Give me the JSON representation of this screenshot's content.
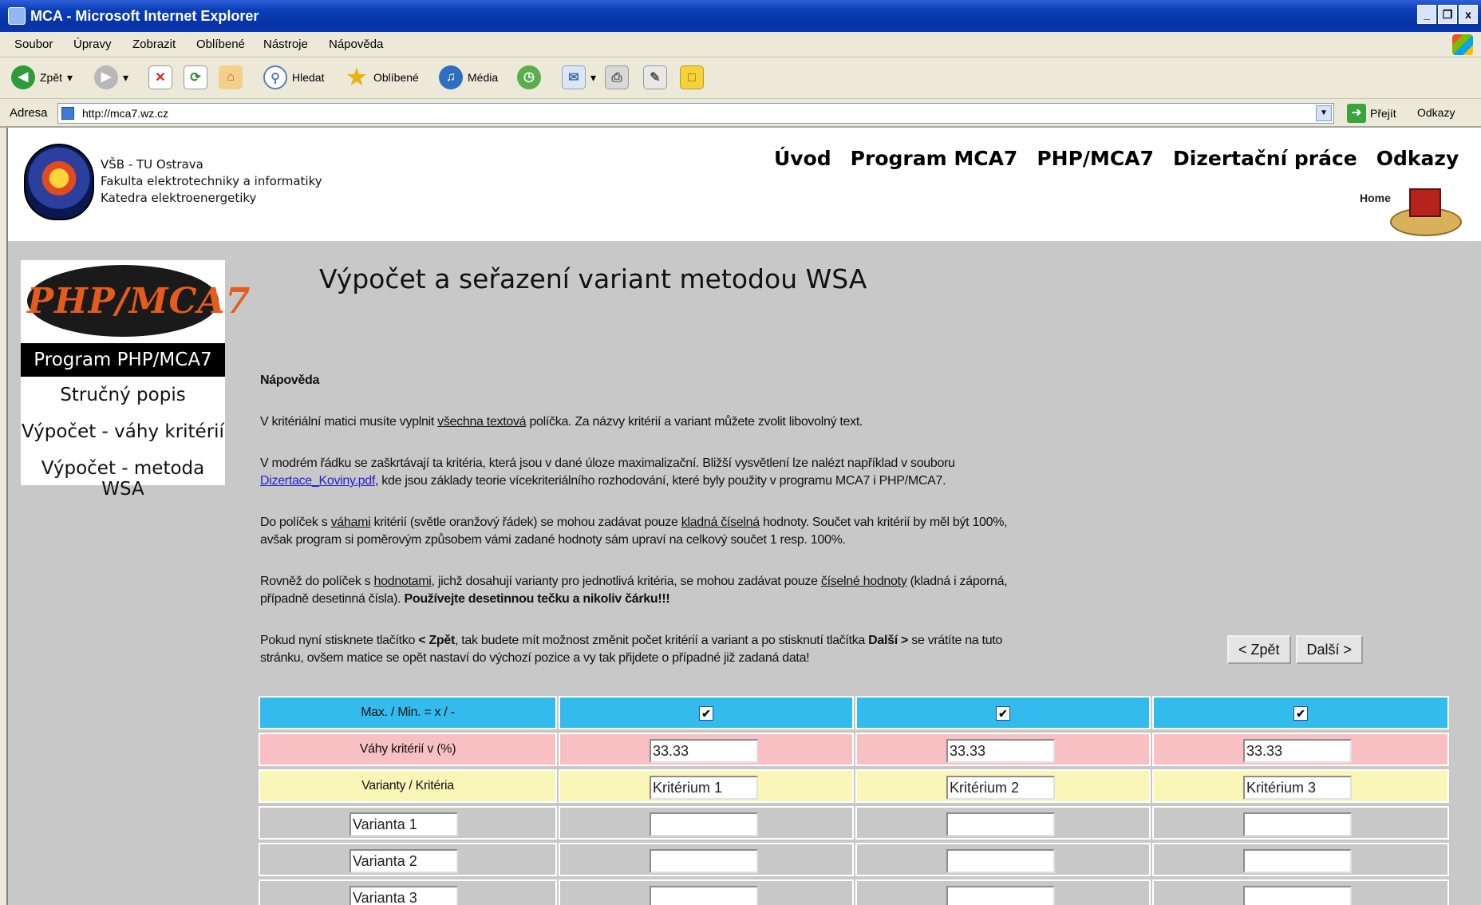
{
  "window": {
    "title": "MCA - Microsoft Internet Explorer",
    "controls": [
      "_",
      "❐",
      "x"
    ]
  },
  "menu": [
    "Soubor",
    "Úpravy",
    "Zobrazit",
    "Oblíbené",
    "Nástroje",
    "Nápověda"
  ],
  "toolbar": {
    "back": "Zpět",
    "search": "Hledat",
    "favorites": "Oblíbené",
    "media": "Média"
  },
  "address": {
    "label": "Adresa",
    "url": "http://mca7.wz.cz",
    "go": "Přejít",
    "links": "Odkazy"
  },
  "header": {
    "uni": [
      "VŠB - TU Ostrava",
      "Fakulta elektrotechniky a informatiky",
      "Katedra elektroenergetiky"
    ],
    "nav": [
      "Úvod",
      "Program MCA7",
      "PHP/MCA7",
      "Dizertační práce",
      "Odkazy"
    ],
    "home": "Home"
  },
  "sidebar": {
    "brand": "PHP/MCA7",
    "current": "Program PHP/MCA7",
    "items": [
      "Stručný popis",
      "Výpočet - váhy kritérií",
      "Výpočet - metoda WSA"
    ]
  },
  "main": {
    "title": "Výpočet a seřazení variant metodou WSA",
    "help_heading": "Nápověda",
    "p1": {
      "a": "V kritériální matici musíte vyplnit ",
      "u": "všechna textová",
      "b": " políčka. Za názvy kritérií a variant můžete zvolit libovolný text."
    },
    "p2": {
      "a": "V modrém řádku se zaškrtávají ta kritéria, která jsou v dané úloze maximalizační. Bližší vysvětlení lze nalézt například v souboru",
      "link": "Dizertace_Koviny.pdf",
      "b": ", kde jsou základy teorie vícekriteriálního rozhodování, které byly použity v programu MCA7 i PHP/MCA7."
    },
    "p3": {
      "a": "Do políček s ",
      "u1": "váhami",
      "b": " kritérií (světle oranžový řádek) se mohou zadávat pouze ",
      "u2": "kladná číselná",
      "c": " hodnoty. Součet vah kritérií by měl být 100%,",
      "d": "avšak program si poměrovým způsobem vámi zadané hodnoty sám upraví na celkový součet 1 resp. 100%."
    },
    "p4": {
      "a": "Rovněž do políček s ",
      "u1": "hodnotami",
      "b": ", jichž dosahují varianty pro jednotlivá kritéria, se mohou zadávat pouze ",
      "u2": "číselné hodnoty",
      "c": " (kladná i záporná,",
      "d": "případně desetinná čísla). ",
      "bold": "Používejte desetinnou tečku a nikoliv čárku!!!"
    },
    "p5": {
      "a": "Pokud nyní stisknete tlačítko ",
      "b1": "< Zpět",
      "b": ", tak budete mít možnost změnit počet kritérií a variant a po stisknutí tlačítka ",
      "b2": "Další >",
      "c": " se vrátíte na tuto",
      "d": "stránku, ovšem matice se opět nastaví do výchozí pozice a vy tak přijdete o případné již zadaná data!"
    },
    "btn_back": "< Zpět",
    "btn_next": "Další >"
  },
  "matrix": {
    "colors": {
      "maxmin": "#33BBEE",
      "weights": "#F9C0C3",
      "names": "#FAF6B8",
      "variants": "#C8C8C8"
    },
    "maxmin_label": "Max. / Min. = x / -",
    "maxmin_checked": [
      "✔",
      "✔",
      "✔"
    ],
    "weights_label": "Váhy kritérií v (%)",
    "weights": [
      "33.33",
      "33.33",
      "33.33"
    ],
    "names_label": "Varianty / Kritéria",
    "criteria": [
      "Kritérium 1",
      "Kritérium 2",
      "Kritérium 3"
    ],
    "variants": [
      "Varianta 1",
      "Varianta 2",
      "Varianta 3"
    ],
    "values": [
      [
        "",
        "",
        ""
      ],
      [
        "",
        "",
        ""
      ],
      [
        "",
        "",
        ""
      ]
    ]
  }
}
